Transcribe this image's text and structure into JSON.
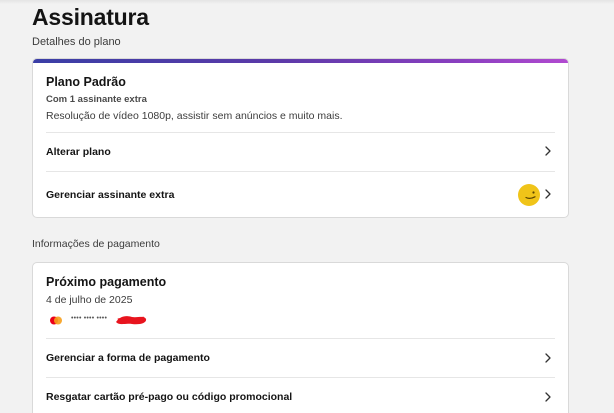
{
  "header": {
    "title": "Assinatura",
    "subtitle": "Detalhes do plano"
  },
  "plan": {
    "name": "Plano Padrão",
    "extra_members": "Com 1 assinante extra",
    "description": "Resolução de vídeo 1080p, assistir sem anúncios e muito mais.",
    "actions": [
      {
        "label": "Alterar plano",
        "icon": "chevron-right-icon"
      },
      {
        "label": "Gerenciar assinante extra",
        "icon": "chevron-right-icon",
        "avatar": "smiley-avatar-icon"
      }
    ],
    "accent_gradient": [
      "#3a3ea6",
      "#8a3fc0",
      "#b14ad0"
    ]
  },
  "payment": {
    "section_label": "Informações de pagamento",
    "title": "Próximo pagamento",
    "date": "4 de julho de 2025",
    "card_icon": "mastercard-icon",
    "card_number_masked": "•••• •••• ••••",
    "actions": [
      {
        "label": "Gerenciar a forma de pagamento",
        "icon": "chevron-right-icon"
      },
      {
        "label": "Resgatar cartão pré-pago ou código promocional",
        "icon": "chevron-right-icon"
      }
    ]
  },
  "colors": {
    "background": "#f2f2f2",
    "card": "#ffffff",
    "avatar_yellow": "#f0c419",
    "redaction_red": "#e8141e",
    "mastercard_red": "#eb001b",
    "mastercard_orange": "#f79e1b"
  }
}
